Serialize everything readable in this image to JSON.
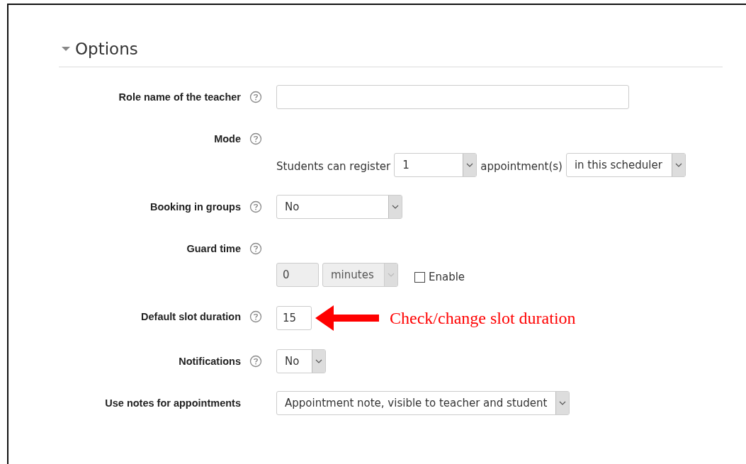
{
  "section": {
    "title": "Options",
    "expanded": true
  },
  "fields": [
    {
      "label": "Role name of the teacher",
      "help": true,
      "kind": "inline",
      "controls": [
        {
          "kind": "text",
          "disabled": false
        }
      ]
    },
    {
      "label": "Mode",
      "help": true,
      "kind": "stacked",
      "controls": [
        {
          "kind": "label",
          "text": "Students can register"
        },
        {
          "kind": "select",
          "value": "1",
          "disabled": false
        },
        {
          "kind": "label",
          "text": "appointment(s)"
        },
        {
          "kind": "select",
          "value": "in this scheduler",
          "disabled": false
        }
      ]
    },
    {
      "label": "Booking in groups",
      "help": true,
      "kind": "inline",
      "controls": [
        {
          "kind": "select",
          "value": "No",
          "disabled": false
        }
      ]
    },
    {
      "label": "Guard time",
      "help": true,
      "kind": "stacked",
      "controls": [
        {
          "kind": "text",
          "value": "0",
          "disabled": true
        },
        {
          "kind": "select",
          "value": "minutes",
          "disabled": true
        },
        {
          "kind": "checkbox",
          "text": "Enable",
          "checked": false
        }
      ]
    },
    {
      "label": "Default slot duration",
      "help": true,
      "kind": "inline",
      "controls": [
        {
          "kind": "text",
          "value": "15",
          "disabled": false
        }
      ],
      "annotation": "Check/change slot duration"
    },
    {
      "label": "Notifications",
      "help": true,
      "kind": "inline",
      "controls": [
        {
          "kind": "select",
          "value": "No",
          "disabled": false
        }
      ]
    },
    {
      "label": "Use notes for appointments",
      "help": false,
      "kind": "inline",
      "controls": [
        {
          "kind": "select",
          "value": "Appointment note, visible to teacher and student",
          "disabled": false
        }
      ]
    }
  ]
}
